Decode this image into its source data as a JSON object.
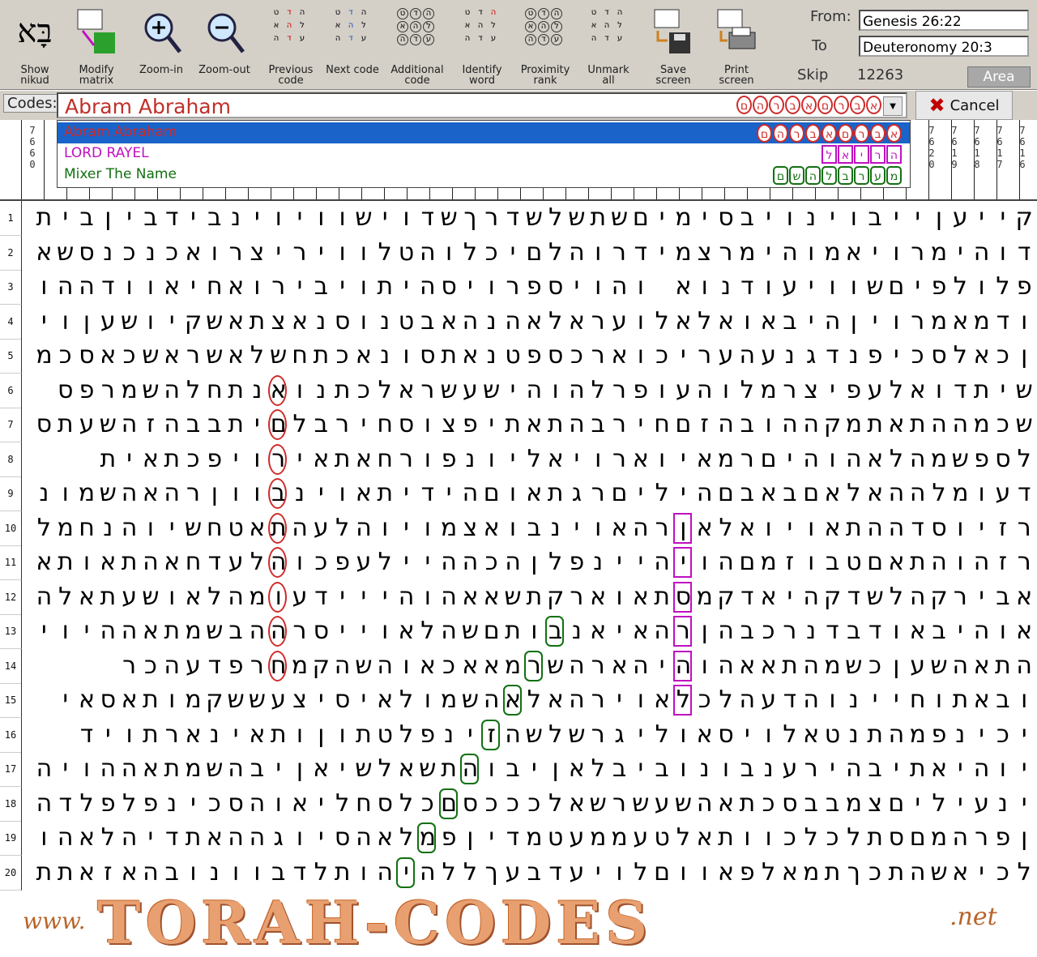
{
  "toolbar": {
    "buttons": [
      {
        "key": "show-nikud",
        "label": "Show nikud",
        "icon": "hebrew-letters-icon"
      },
      {
        "key": "modify-matrix",
        "label": "Modify matrix",
        "icon": "matrix-grid-icon"
      },
      {
        "key": "zoom-in",
        "label": "Zoom-in",
        "icon": "zoom-in-icon"
      },
      {
        "key": "zoom-out",
        "label": "Zoom-out",
        "icon": "zoom-out-icon"
      },
      {
        "key": "previous-code",
        "label": "Previous code",
        "icon": "previous-arrow-icon"
      },
      {
        "key": "next-code",
        "label": "Next code",
        "icon": "next-arrow-icon"
      },
      {
        "key": "additional-code",
        "label": "Additional code",
        "icon": "circles-grid-icon"
      },
      {
        "key": "identify-word",
        "label": "Identify word",
        "icon": "identify-grid-icon"
      },
      {
        "key": "proximity-rank",
        "label": "Proximity rank",
        "icon": "proximity-grid-icon"
      },
      {
        "key": "unmark-all",
        "label": "Unmark all",
        "icon": "unmark-grid-icon"
      },
      {
        "key": "save-screen",
        "label": "Save screen",
        "icon": "floppy-disk-icon"
      },
      {
        "key": "print-screen",
        "label": "Print screen",
        "icon": "printer-icon"
      }
    ],
    "nikud_glyph": "בָּא",
    "grid_glyphs": [
      "ט",
      "ד",
      "ה",
      "א",
      "ה",
      "ל",
      "ה",
      "ד",
      "ע"
    ]
  },
  "range": {
    "from_label": "From:",
    "from_value": "Genesis 26:22",
    "to_label": "To",
    "to_value": "Deuteronomy 20:3",
    "skip_label": "Skip",
    "skip_value": "12263",
    "area_label": "Area"
  },
  "codes": {
    "label": "Codes:",
    "value": "Abram Abraham",
    "value_chips": [
      "ם",
      "ה",
      "ר",
      "ב",
      "א",
      "ם",
      "ר",
      "ב",
      "א"
    ],
    "cancel_label": "Cancel"
  },
  "dropdown": {
    "items": [
      {
        "name": "Abram Abraham",
        "color": "#d02a2a",
        "selected": true,
        "chips": [
          "ם",
          "ה",
          "ר",
          "ב",
          "א",
          "ם",
          "ר",
          "ב",
          "א"
        ]
      },
      {
        "name": "LORD RAYEL",
        "color": "#c010c0",
        "selected": false,
        "chips": [
          "ל",
          "א",
          "י",
          "ר",
          "ה"
        ]
      },
      {
        "name": "Mixer The Name",
        "color": "#127012",
        "selected": false,
        "chips": [
          "ם",
          "ש",
          "ה",
          "ל",
          "ב",
          "ר",
          "ע",
          "מ"
        ]
      }
    ]
  },
  "column_numbers": {
    "left": "7660",
    "right": [
      "7620",
      "7619",
      "7618",
      "7617",
      "7616"
    ]
  },
  "matrix": {
    "rows": [
      "קייעןייבוינויבסימיםשתשלשדרךשדוישוויוינבידביןביתוייםוישבשכבםו",
      "דוהימרויאמוהימרצמידרוהלםיכלוהטלוויריצרואכנכנסשאינשםה",
      "פלולפיםשוויעודנוא והויספרויסהיתויבירואחיאוודההויאיההובוירעה",
      "ודמאמרויןהיבאואלאלועראלאהנהאבטנוסנאצתאשקיושעןויושהשמ",
      "ןכאלסכיפנדגנעהעריכוארכספטנאתסונאכתחשלאשראשכאסכמעההו",
      "שיתדואלעפיצרמלוהעופרלהוהישעשראלכתנואנתחלהשמרפס",
      "שכמההתאתמקההובהזםחירבהתאתיפצוסחירבלםיתבבהזהשעתס",
      "לספשמהלאהוהיםרמאיוארויאליונפורחאתאירויפכתאית",
      "דעומלההאלאםבאבםהיליםרגתאוםהידיתאוינבווןרהאהשמונמ",
      "רזיוסדההתאויואלאןרהאוינבואצמויוהלעהתאטחשיוהנחמלקוח",
      "רזהוהתאםטבוזמםהויהיינפלןהכההיילעפכוהלעדחאהתאותא",
      "אבירקהלשדקהיאדקמסתאוארקתשאאהוהייידעומהלאושעתאלה",
      "אוהיבאודבדנרכבהןרהאיאנבותםשהלאוייסרההבשמתאההיוי",
      "התאהשעןכשמהתאאהוהיהארהשרמאאכאוהשהקמחרפדעהכר",
      "ובאתוחיינוהדעהלכלאוירהאלאהשמולאיסיצעששקמותאסאי",
      "יכינפמהתנטאלויסאוליגרשלשהזינפלטתוןותאינארתויד",
      "יוהיאתיבהירענבונוביבלאןיבוהתשאלשיאןיבהשמתאההויהי",
      "ינעיליםצמבבסכתאהשעשרשאלכככסםכלסחליאוהסכינפלפלדההס",
      "ןפרהמםסתלכלכוותאלטעממעטמדיןפמלאהסיוגההאתדיהלאהו",
      "לכיאשהתכךתמאלפאווםלויעדבעךללהיהותלדבוונובהאזאתתנוע"
    ],
    "row_numbers": [
      "1",
      "2",
      "3",
      "4",
      "5",
      "6",
      "7",
      "8",
      "9",
      "10",
      "11",
      "12",
      "13",
      "14",
      "15",
      "16",
      "17",
      "18",
      "19",
      "20"
    ],
    "marks": [
      {
        "row": 6,
        "col": 36,
        "color": "#d02a2a",
        "shape": "oval"
      },
      {
        "row": 7,
        "col": 36,
        "color": "#d02a2a",
        "shape": "oval"
      },
      {
        "row": 8,
        "col": 36,
        "color": "#d02a2a",
        "shape": "oval"
      },
      {
        "row": 9,
        "col": 36,
        "color": "#d02a2a",
        "shape": "oval"
      },
      {
        "row": 10,
        "col": 36,
        "color": "#d02a2a",
        "shape": "oval"
      },
      {
        "row": 11,
        "col": 36,
        "color": "#d02a2a",
        "shape": "oval"
      },
      {
        "row": 12,
        "col": 36,
        "color": "#d02a2a",
        "shape": "oval"
      },
      {
        "row": 13,
        "col": 36,
        "color": "#d02a2a",
        "shape": "oval"
      },
      {
        "row": 14,
        "col": 36,
        "color": "#d02a2a",
        "shape": "oval"
      },
      {
        "row": 10,
        "col": 17,
        "color": "#c010c0",
        "shape": "rect"
      },
      {
        "row": 11,
        "col": 17,
        "color": "#c010c0",
        "shape": "rect"
      },
      {
        "row": 12,
        "col": 17,
        "color": "#c010c0",
        "shape": "rect"
      },
      {
        "row": 13,
        "col": 17,
        "color": "#c010c0",
        "shape": "rect"
      },
      {
        "row": 14,
        "col": 17,
        "color": "#c010c0",
        "shape": "rect"
      },
      {
        "row": 15,
        "col": 17,
        "color": "#c010c0",
        "shape": "rect"
      },
      {
        "row": 13,
        "col": 23,
        "color": "#127012",
        "shape": "round"
      },
      {
        "row": 14,
        "col": 24,
        "color": "#127012",
        "shape": "round"
      },
      {
        "row": 15,
        "col": 25,
        "color": "#127012",
        "shape": "round"
      },
      {
        "row": 16,
        "col": 26,
        "color": "#127012",
        "shape": "round"
      },
      {
        "row": 17,
        "col": 27,
        "color": "#127012",
        "shape": "round"
      },
      {
        "row": 18,
        "col": 28,
        "color": "#127012",
        "shape": "round"
      },
      {
        "row": 19,
        "col": 29,
        "color": "#127012",
        "shape": "round"
      },
      {
        "row": 20,
        "col": 30,
        "color": "#127012",
        "shape": "round"
      }
    ]
  },
  "banner": {
    "www": "www.",
    "main": "TORAH-CODES",
    "net": ".net"
  }
}
